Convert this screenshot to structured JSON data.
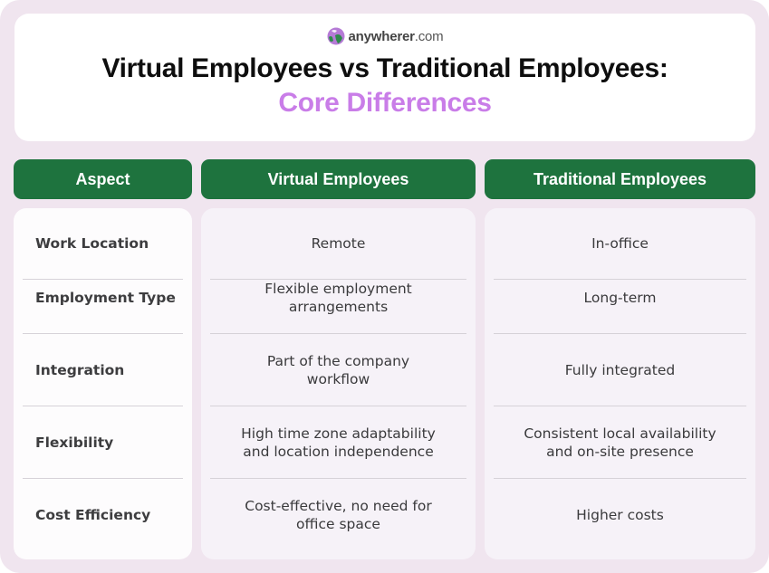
{
  "brand": {
    "name_bold": "anywherer",
    "name_suffix": ".com",
    "icon": "globe-logo-icon"
  },
  "title": {
    "line1": "Virtual Employees vs Traditional Employees:",
    "line2": "Core Differences"
  },
  "colors": {
    "header_green": "#1e733e",
    "accent_purple": "#c97de8",
    "frame_bg": "#f0e5ef"
  },
  "table": {
    "headers": [
      "Aspect",
      "Virtual Employees",
      "Traditional Employees"
    ],
    "rows": [
      {
        "aspect": "Work Location",
        "virtual": "Remote",
        "traditional": "In-office"
      },
      {
        "aspect": "Employment Type",
        "virtual": "Flexible employment\narrangements",
        "traditional": "Long-term"
      },
      {
        "aspect": "Integration",
        "virtual": "Part of the company\nworkflow",
        "traditional": "Fully integrated"
      },
      {
        "aspect": "Flexibility",
        "virtual": "High time zone adaptability\nand location independence",
        "traditional": "Consistent local availability\nand on-site presence"
      },
      {
        "aspect": "Cost Efficiency",
        "virtual": "Cost-effective, no need for\noffice space",
        "traditional": "Higher costs"
      }
    ]
  }
}
